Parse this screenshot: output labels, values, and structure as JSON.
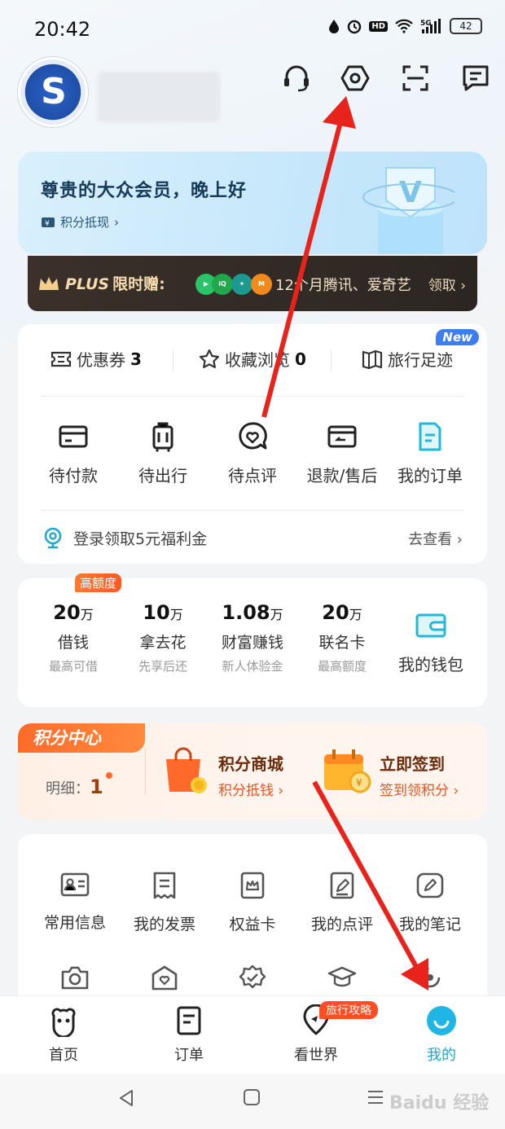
{
  "status_bar": {
    "time": "20:42",
    "hd": "HD",
    "battery": "42"
  },
  "header": {
    "avatar_alt": "快乐分享"
  },
  "member": {
    "greeting": "尊贵的大众会员，晚上好",
    "points_cash": "积分抵现"
  },
  "plus": {
    "prefix": "PLUS",
    "label": "限时赠:",
    "promo": "12个月腾讯、爱奇艺",
    "action": "领取"
  },
  "quick": {
    "coupons_label": "优惠券",
    "coupons_count": "3",
    "favorites_label": "收藏浏览",
    "favorites_count": "0",
    "footprint_label": "旅行足迹",
    "new_badge": "New"
  },
  "orders": [
    {
      "label": "待付款"
    },
    {
      "label": "待出行"
    },
    {
      "label": "待点评"
    },
    {
      "label": "退款/售后"
    },
    {
      "label": "我的订单"
    }
  ],
  "coupon_line": {
    "text": "登录领取5元福利金",
    "action": "去查看"
  },
  "finance": {
    "badge": "高额度",
    "items": [
      {
        "amount": "20",
        "unit": "万",
        "name": "借钱",
        "desc": "最高可借"
      },
      {
        "amount": "10",
        "unit": "万",
        "name": "拿去花",
        "desc": "先享后还"
      },
      {
        "amount": "1.08",
        "unit": "万",
        "name": "财富赚钱",
        "desc": "新人体验金"
      },
      {
        "amount": "20",
        "unit": "万",
        "name": "联名卡",
        "desc": "最高额度"
      }
    ],
    "wallet": "我的钱包"
  },
  "points": {
    "tag": "积分中心",
    "detail_label": "明细：",
    "detail_value": "1",
    "mall_title": "积分商城",
    "mall_sub": "积分抵钱",
    "checkin_title": "立即签到",
    "checkin_sub": "签到领积分"
  },
  "tools": [
    {
      "label": "常用信息"
    },
    {
      "label": "我的发票"
    },
    {
      "label": "权益卡"
    },
    {
      "label": "我的点评"
    },
    {
      "label": "我的笔记"
    }
  ],
  "tabs": [
    {
      "label": "首页"
    },
    {
      "label": "订单"
    },
    {
      "label": "看世界"
    },
    {
      "label": "我的"
    }
  ],
  "tab_badge": "旅行攻略",
  "watermark": "Baidu 经验"
}
